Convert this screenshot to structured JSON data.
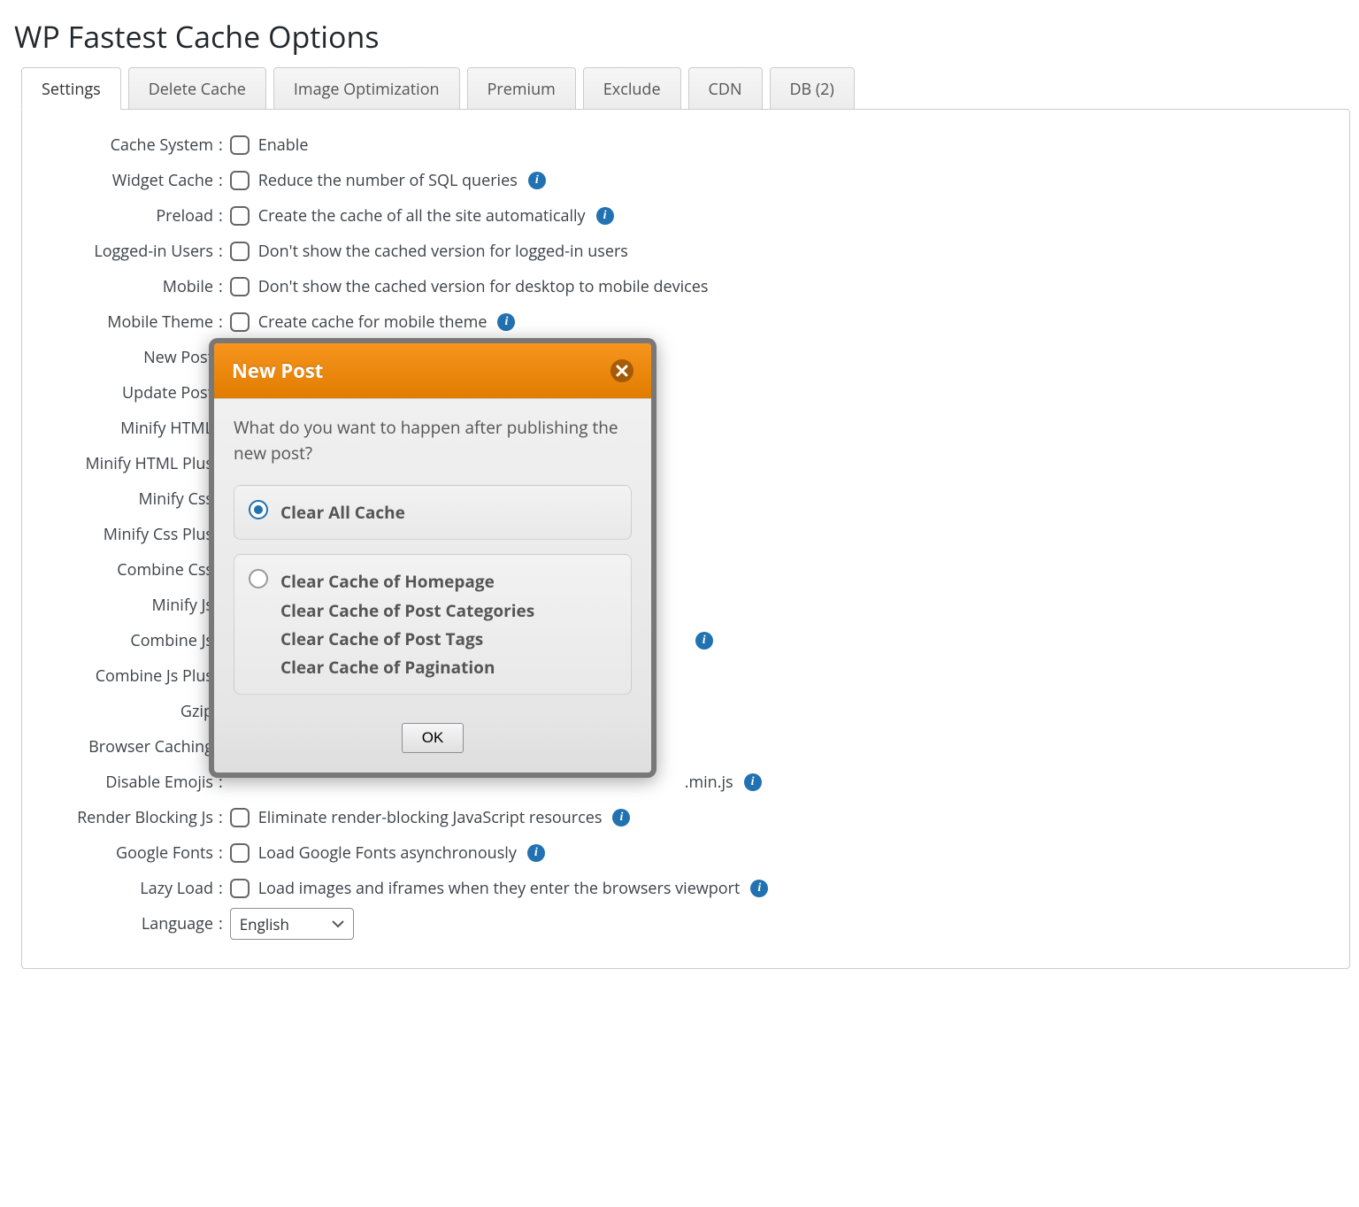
{
  "page": {
    "title": "WP Fastest Cache Options"
  },
  "tabs": [
    {
      "label": "Settings",
      "active": true
    },
    {
      "label": "Delete Cache"
    },
    {
      "label": "Image Optimization"
    },
    {
      "label": "Premium"
    },
    {
      "label": "Exclude"
    },
    {
      "label": "CDN"
    },
    {
      "label": "DB (2)"
    }
  ],
  "settings": {
    "rows": [
      {
        "label": "Cache System",
        "desc": "Enable",
        "info": false
      },
      {
        "label": "Widget Cache",
        "desc": "Reduce the number of SQL queries",
        "info": true
      },
      {
        "label": "Preload",
        "desc": "Create the cache of all the site automatically",
        "info": true
      },
      {
        "label": "Logged-in Users",
        "desc": "Don't show the cached version for logged-in users",
        "info": false
      },
      {
        "label": "Mobile",
        "desc": "Don't show the cached version for desktop to mobile devices",
        "info": false
      },
      {
        "label": "Mobile Theme",
        "desc": "Create cache for mobile theme",
        "info": true
      }
    ],
    "hiddenRows": [
      {
        "label": "New Post"
      },
      {
        "label": "Update Post"
      },
      {
        "label": "Minify HTML"
      },
      {
        "label": "Minify HTML Plus"
      },
      {
        "label": "Minify Css"
      },
      {
        "label": "Minify Css Plus"
      },
      {
        "label": "Combine Css"
      },
      {
        "label": "Minify Js"
      },
      {
        "label": "Combine Js",
        "info": true
      },
      {
        "label": "Combine Js Plus"
      },
      {
        "label": "Gzip"
      },
      {
        "label": "Browser Caching"
      },
      {
        "label": "Disable Emojis",
        "suffix": ".min.js",
        "info": true
      }
    ],
    "tailRows": [
      {
        "label": "Render Blocking Js",
        "desc": "Eliminate render-blocking JavaScript resources",
        "info": true
      },
      {
        "label": "Google Fonts",
        "desc": "Load Google Fonts asynchronously",
        "info": true
      },
      {
        "label": "Lazy Load",
        "desc": "Load images and iframes when they enter the browsers viewport",
        "info": true
      }
    ],
    "language": {
      "label": "Language",
      "value": "English"
    }
  },
  "modal": {
    "title": "New Post",
    "question": "What do you want to happen after publishing the new post?",
    "options": [
      {
        "selected": true,
        "lines": [
          "Clear All Cache"
        ]
      },
      {
        "selected": false,
        "lines": [
          "Clear Cache of Homepage",
          "Clear Cache of Post Categories",
          "Clear Cache of Post Tags",
          "Clear Cache of Pagination"
        ]
      }
    ],
    "ok_label": "OK"
  }
}
